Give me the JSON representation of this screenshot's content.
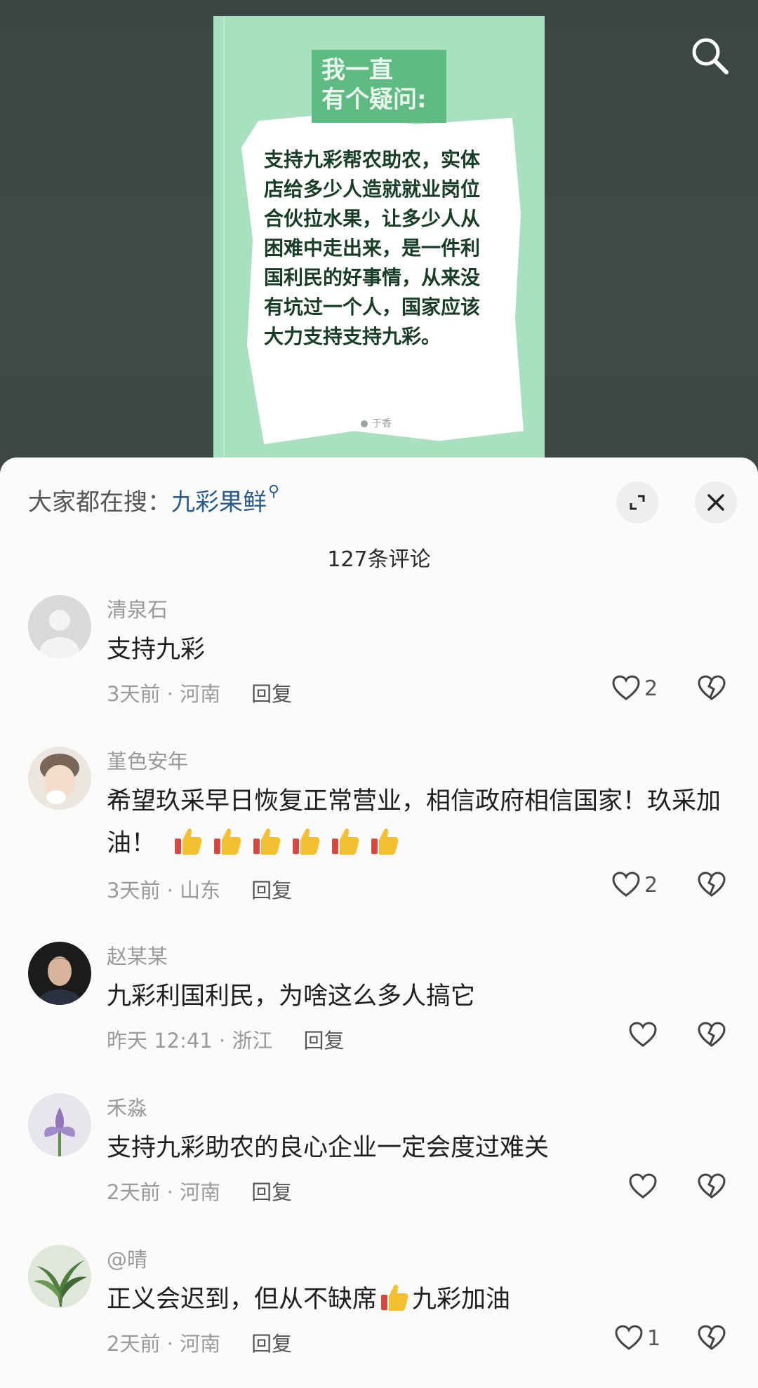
{
  "post": {
    "title_line1": "我一直",
    "title_line2": "有个疑问:",
    "body": "支持九彩帮农助农，实体店给多少人造就就业岗位合伙拉水果，让多少人从困难中走出来，是一件利国利民的好事情，从来没有坑过一个人，国家应该大力支持支持九彩。",
    "footer": "于香"
  },
  "sheet": {
    "hot_search_label": "大家都在搜：",
    "hot_search_term": "九彩果鲜",
    "comment_count": "127条评论"
  },
  "comments": [
    {
      "author": "清泉石",
      "text": "支持九彩",
      "time_loc": "3天前 · 河南",
      "reply": "回复",
      "likes": "2"
    },
    {
      "author": "堇色安年",
      "text": "希望玖采早日恢复正常营业，相信政府相信国家！玖采加油！",
      "time_loc": "3天前 · 山东",
      "reply": "回复",
      "likes": "2"
    },
    {
      "author": "赵某某",
      "text": "九彩利国利民，为啥这么多人搞它",
      "time_loc": "昨天 12:41 · 浙江",
      "reply": "回复",
      "likes": ""
    },
    {
      "author": "禾淼",
      "text": "支持九彩助农的良心企业一定会度过难关",
      "time_loc": "2天前 · 河南",
      "reply": "回复",
      "likes": ""
    },
    {
      "author": "@晴",
      "text_before": "正义会迟到，但从不缺席",
      "text_after": "九彩加油",
      "time_loc": "2天前 · 河南",
      "reply": "回复",
      "likes": "1"
    }
  ],
  "icons": {
    "search": "search-icon",
    "expand": "expand-icon",
    "close": "close-icon",
    "like": "heart-icon",
    "dislike": "broken-heart-icon",
    "thumbs_up": "thumbs-up-emoji"
  },
  "colors": {
    "post_bg": "#a9e1c0",
    "accent_link": "#2e5c8a",
    "sheet_bg": "#fbfbf9"
  }
}
